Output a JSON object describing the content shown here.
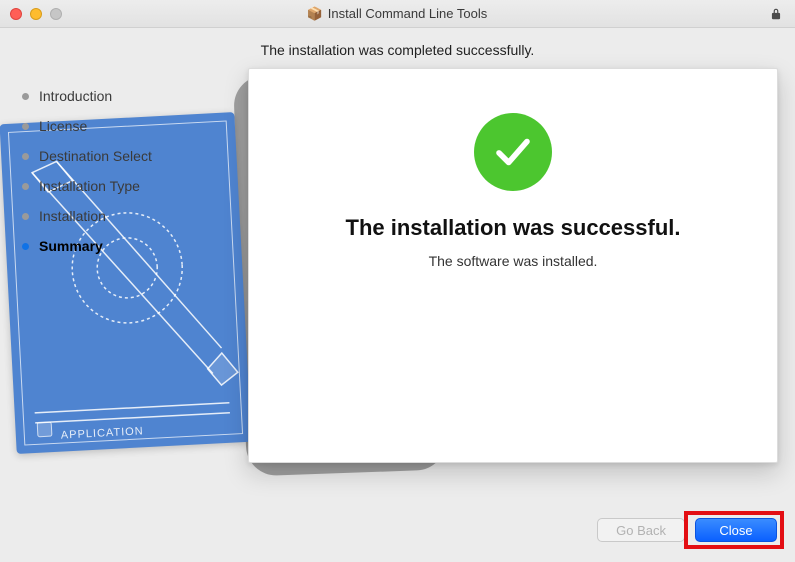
{
  "window": {
    "title": "Install Command Line Tools"
  },
  "heading": "The installation was completed successfully.",
  "steps": [
    {
      "label": "Introduction",
      "active": false
    },
    {
      "label": "License",
      "active": false
    },
    {
      "label": "Destination Select",
      "active": false
    },
    {
      "label": "Installation Type",
      "active": false
    },
    {
      "label": "Installation",
      "active": false
    },
    {
      "label": "Summary",
      "active": true
    }
  ],
  "panel": {
    "title": "The installation was successful.",
    "subtitle": "The software was installed."
  },
  "footer": {
    "goback_label": "Go Back",
    "close_label": "Close"
  },
  "colors": {
    "success_green": "#4cc62f",
    "primary_blue": "#0a60ff",
    "highlight_red": "#e30e13"
  }
}
